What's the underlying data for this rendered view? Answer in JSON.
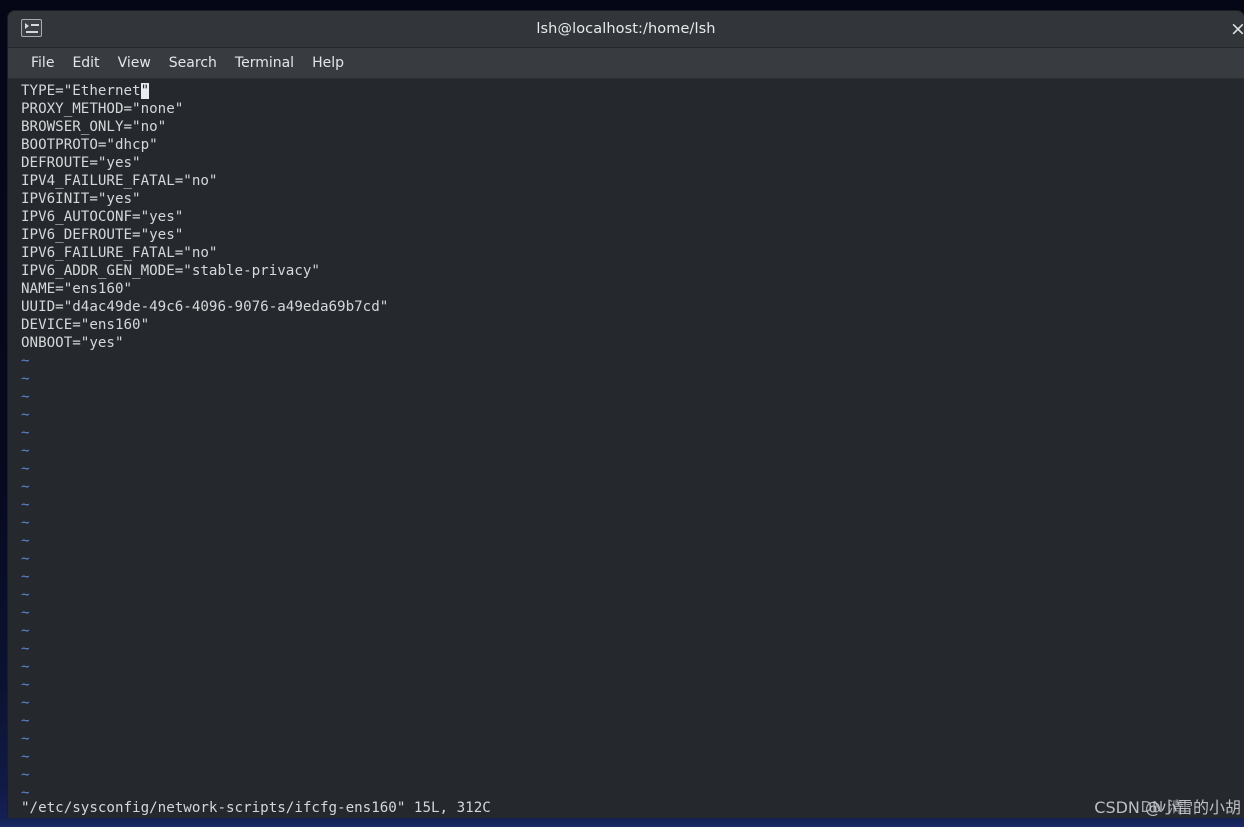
{
  "window": {
    "title": "lsh@localhost:/home/lsh",
    "icon": "terminal-icon",
    "close_label": "×"
  },
  "menubar": {
    "items": [
      {
        "label": "File"
      },
      {
        "label": "Edit"
      },
      {
        "label": "View"
      },
      {
        "label": "Search"
      },
      {
        "label": "Terminal"
      },
      {
        "label": "Help"
      }
    ]
  },
  "editor": {
    "program": "vim",
    "lines": [
      "TYPE=\"Ethernet",
      "PROXY_METHOD=\"none\"",
      "BROWSER_ONLY=\"no\"",
      "BOOTPROTO=\"dhcp\"",
      "DEFROUTE=\"yes\"",
      "IPV4_FAILURE_FATAL=\"no\"",
      "IPV6INIT=\"yes\"",
      "IPV6_AUTOCONF=\"yes\"",
      "IPV6_DEFROUTE=\"yes\"",
      "IPV6_FAILURE_FATAL=\"no\"",
      "IPV6_ADDR_GEN_MODE=\"stable-privacy\"",
      "NAME=\"ens160\"",
      "UUID=\"d4ac49de-49c6-4096-9076-a49eda69b7cd\"",
      "DEVICE=\"ens160\"",
      "ONBOOT=\"yes\""
    ],
    "cursor_char": "\"",
    "cursor_line": 1,
    "empty_marker": "~",
    "empty_marker_count": 25,
    "status": "\"/etc/sysconfig/network-scripts/ifcfg-ens160\" 15L, 312C",
    "file_path": "/etc/sysconfig/network-scripts/ifcfg-ens160",
    "line_count": "15L",
    "char_count": "312C"
  },
  "watermark": {
    "front": "CSDN @小雷的小胡",
    "back": "DN 清"
  },
  "colors": {
    "desktop": "#06081c",
    "titlebar": "#32363a",
    "menubar": "#383c40",
    "terminal_bg": "#25282c",
    "terminal_fg": "#d5d8da",
    "tilde": "#5f86d4",
    "cursor": "#e9ecee"
  }
}
